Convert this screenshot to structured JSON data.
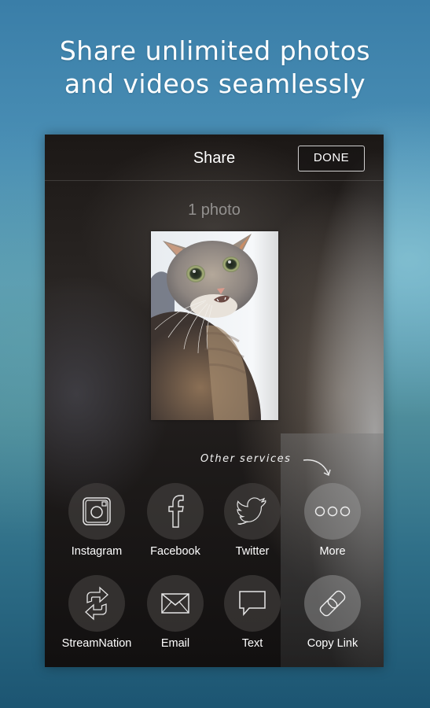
{
  "headline": {
    "line1": "Share unlimited photos",
    "line2": "and videos seamlessly"
  },
  "share_screen": {
    "title": "Share",
    "done_label": "DONE",
    "count_label": "1 photo",
    "photo_alt": "Photo of a tabby cat",
    "other_services_hint": "Other services",
    "services": [
      {
        "label": "Instagram",
        "icon": "instagram-icon"
      },
      {
        "label": "Facebook",
        "icon": "facebook-icon"
      },
      {
        "label": "Twitter",
        "icon": "twitter-icon"
      },
      {
        "label": "More",
        "icon": "more-icon"
      },
      {
        "label": "StreamNation",
        "icon": "streamnation-icon"
      },
      {
        "label": "Email",
        "icon": "email-icon"
      },
      {
        "label": "Text",
        "icon": "text-message-icon"
      },
      {
        "label": "Copy Link",
        "icon": "link-icon"
      }
    ]
  }
}
